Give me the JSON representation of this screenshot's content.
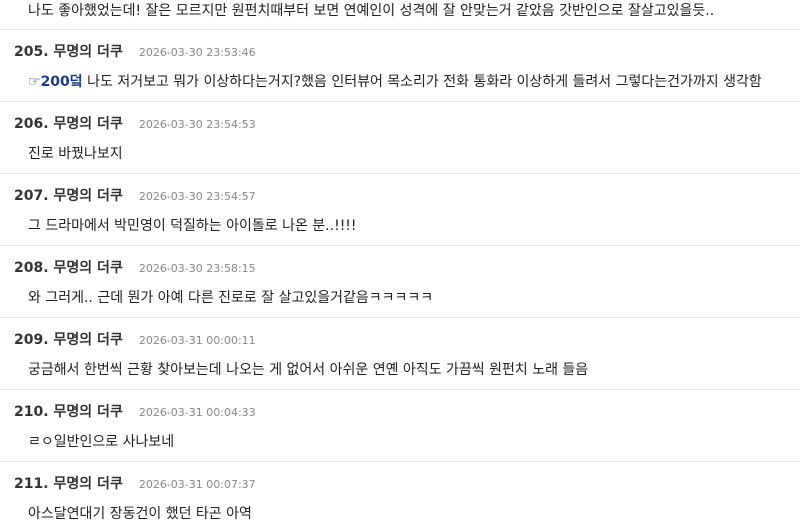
{
  "lead_comment": {
    "body": "나도 좋아했었는데! 잘은 모르지만 원펀치때부터 보면 연예인이 성격에 잘 안맞는거 같았음 갓반인으로 잘살고있을듯.."
  },
  "comments": [
    {
      "number": "205.",
      "author": "무명의 더쿠",
      "timestamp": "2026-03-30 23:53:46",
      "reply_icon": "☞",
      "reply_anchor": "200덬",
      "body": " 나도 저거보고 뭐가 이상하다는거지?했음 인터뷰어 목소리가 전화 통화라 이상하게 들려서 그렇다는건가까지 생각함"
    },
    {
      "number": "206.",
      "author": "무명의 더쿠",
      "timestamp": "2026-03-30 23:54:53",
      "body": "진로 바꿨나보지"
    },
    {
      "number": "207.",
      "author": "무명의 더쿠",
      "timestamp": "2026-03-30 23:54:57",
      "body": "그 드라마에서 박민영이 덕질하는 아이돌로 나온 분..!!!!"
    },
    {
      "number": "208.",
      "author": "무명의 더쿠",
      "timestamp": "2026-03-30 23:58:15",
      "body": "와 그러게.. 근데 뭔가 아예 다른 진로로 잘 살고있을거같음ㅋㅋㅋㅋㅋ"
    },
    {
      "number": "209.",
      "author": "무명의 더쿠",
      "timestamp": "2026-03-31 00:00:11",
      "body": "궁금해서 한번씩 근황 찾아보는데 나오는 게 없어서 아쉬운 연옌 아직도 가끔씩 원펀치 노래 들음"
    },
    {
      "number": "210.",
      "author": "무명의 더쿠",
      "timestamp": "2026-03-31 00:04:33",
      "body": "ㄹㅇ일반인으로 사나보네"
    },
    {
      "number": "211.",
      "author": "무명의 더쿠",
      "timestamp": "2026-03-31 00:07:37",
      "body": "아스달연대기 장동건이 했던 타곤 아역"
    }
  ]
}
